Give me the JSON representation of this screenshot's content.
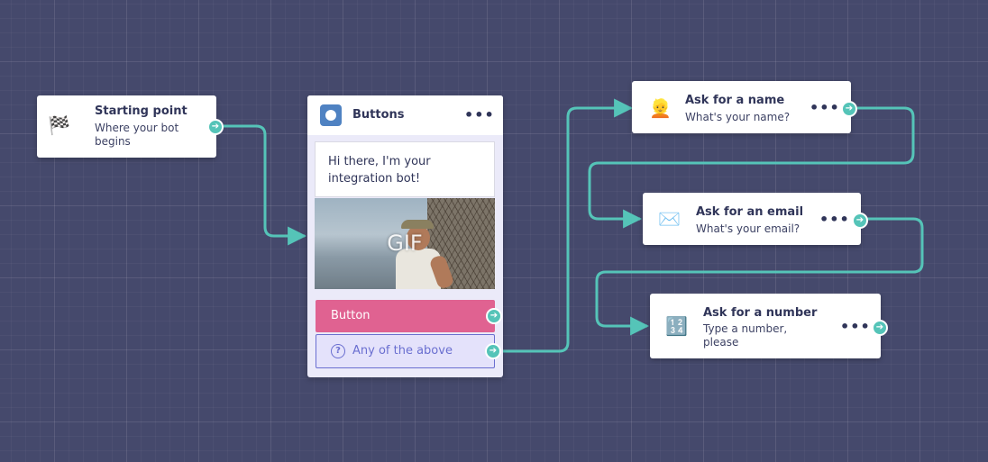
{
  "nodes": {
    "start": {
      "icon": "chequered-flag-icon",
      "emoji": "🏁",
      "title": "Starting point",
      "subtitle": "Where your bot begins"
    },
    "buttons": {
      "icon": "buttons-block-icon",
      "title": "Buttons",
      "menu": "•••",
      "message": "Hi there, I'm your integration bot!",
      "gif_label": "GIF",
      "options": [
        {
          "label": "Button",
          "color": "#e06291"
        },
        {
          "icon": "question-circle-icon",
          "label": "Any of the above",
          "color": "#e4e2fb"
        }
      ]
    },
    "ask_name": {
      "icon": "person-face-icon",
      "emoji": "👱",
      "title": "Ask for a name",
      "subtitle": "What's your name?",
      "menu": "•••"
    },
    "ask_email": {
      "icon": "envelope-icon",
      "emoji": "✉️",
      "title": "Ask for an email",
      "subtitle": "What's your email?",
      "menu": "•••"
    },
    "ask_number": {
      "icon": "input-numbers-icon",
      "emoji": "🔢",
      "title": "Ask for a number",
      "subtitle": "Type a number, please",
      "menu": "•••"
    }
  },
  "colors": {
    "canvas": "#45496c",
    "connector": "#55c4b8",
    "accent": "#4f82c2",
    "text": "#303559"
  }
}
